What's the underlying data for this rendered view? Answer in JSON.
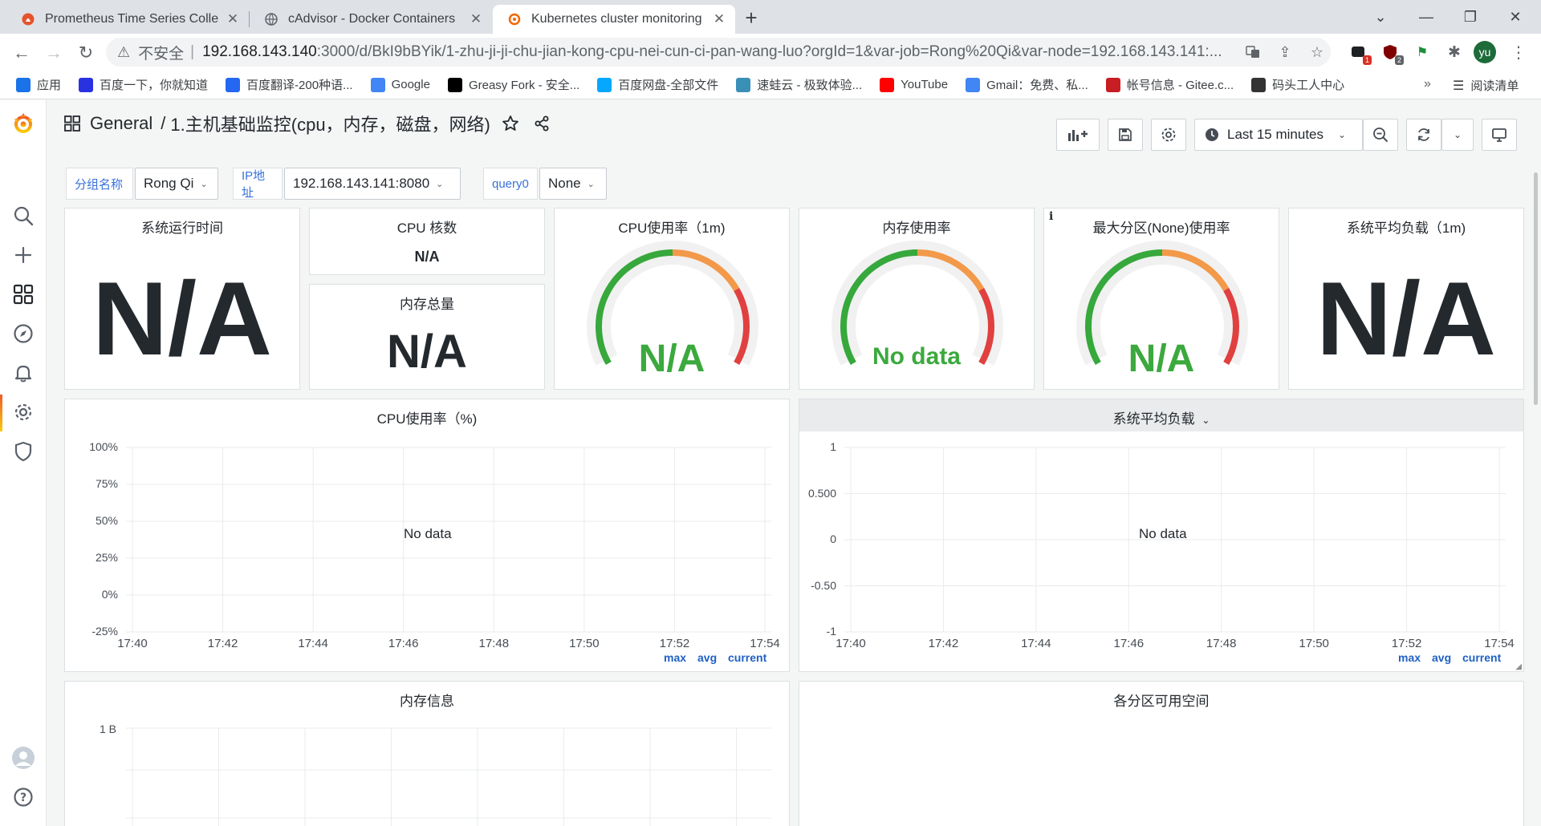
{
  "browser": {
    "tabs": [
      {
        "title": "Prometheus Time Series Colle",
        "active": false
      },
      {
        "title": "cAdvisor - Docker Containers",
        "active": false
      },
      {
        "title": "Kubernetes cluster monitoring",
        "active": true
      }
    ],
    "url_security": "不安全",
    "url_host": "192.168.143.140",
    "url_path": ":3000/d/BkI9bBYik/1-zhu-ji-ji-chu-jian-kong-cpu-nei-cun-ci-pan-wang-luo?orgId=1&var-job=Rong%20Qi&var-node=192.168.143.141:...",
    "profile_initial": "yu",
    "ext_badges": [
      "1",
      "2"
    ],
    "bookmarks": [
      {
        "label": "应用",
        "icon": "apps-grid-icon",
        "color": "#1a73e8"
      },
      {
        "label": "百度一下，你就知道",
        "icon": "baidu-paw-icon",
        "color": "#2932e1"
      },
      {
        "label": "百度翻译-200种语...",
        "icon": "translate-icon",
        "color": "#2468f2"
      },
      {
        "label": "Google",
        "icon": "google-g-icon",
        "color": "#4285f4"
      },
      {
        "label": "Greasy Fork - 安全...",
        "icon": "greasyfork-icon",
        "color": "#000000"
      },
      {
        "label": "百度网盘-全部文件",
        "icon": "baidu-pan-icon",
        "color": "#06a7ff"
      },
      {
        "label": "速蛙云 - 极致体验...",
        "icon": "frog-icon",
        "color": "#3a8fb7"
      },
      {
        "label": "YouTube",
        "icon": "youtube-icon",
        "color": "#ff0000"
      },
      {
        "label": "Gmail：免费、私...",
        "icon": "google-g-icon",
        "color": "#4285f4"
      },
      {
        "label": "帐号信息 - Gitee.c...",
        "icon": "gitee-icon",
        "color": "#c71d23"
      },
      {
        "label": "码头工人中心",
        "icon": "docker-hub-icon",
        "color": "#333333"
      }
    ],
    "reading_list": "阅读清单",
    "bookmarks_more": "»"
  },
  "dashboard": {
    "folder": "General",
    "separator": "/",
    "title": "1.主机基础监控(cpu，内存，磁盘，网络)",
    "time_range": "Last 15 minutes",
    "variables": [
      {
        "label": "分组名称",
        "value": "Rong Qi"
      },
      {
        "label": "IP地址",
        "value": "192.168.143.141:8080"
      },
      {
        "label": "query0",
        "value": "None"
      }
    ]
  },
  "panels": {
    "uptime": {
      "title": "系统运行时间",
      "value": "N/A"
    },
    "cpu_cores": {
      "title": "CPU 核数",
      "value": "N/A"
    },
    "mem_total": {
      "title": "内存总量",
      "value": "N/A"
    },
    "cpu_usage": {
      "title": "CPU使用率（1m)",
      "value": "N/A"
    },
    "mem_usage": {
      "title": "内存使用率",
      "value": "No data"
    },
    "max_partition": {
      "title": "最大分区(None)使用率",
      "value": "N/A",
      "info": "i"
    },
    "load_avg": {
      "title": "系统平均负载（1m)",
      "value": "N/A"
    },
    "cpu_graph": {
      "title": "CPU使用率（%)",
      "no_data": "No data",
      "y_ticks": [
        "100%",
        "75%",
        "50%",
        "25%",
        "0%",
        "-25%"
      ],
      "x_ticks": [
        "17:40",
        "17:42",
        "17:44",
        "17:46",
        "17:48",
        "17:50",
        "17:52",
        "17:54"
      ],
      "legend": [
        "max",
        "avg",
        "current"
      ]
    },
    "load_graph": {
      "title": "系统平均负载",
      "no_data": "No data",
      "y_ticks": [
        "1",
        "0.500",
        "0",
        "-0.50",
        "-1"
      ],
      "x_ticks": [
        "17:40",
        "17:42",
        "17:44",
        "17:46",
        "17:48",
        "17:50",
        "17:52",
        "17:54"
      ],
      "legend": [
        "max",
        "avg",
        "current"
      ]
    },
    "mem_info": {
      "title": "内存信息",
      "y_ticks": [
        "1 B"
      ]
    },
    "partition_space": {
      "title": "各分区可用空间"
    }
  },
  "colors": {
    "gauge_green": "#37a83c",
    "gauge_orange": "#f2994a",
    "gauge_red": "#e0403f",
    "gauge_track": "#f1f1f1",
    "accent_link": "#1f60c4"
  }
}
